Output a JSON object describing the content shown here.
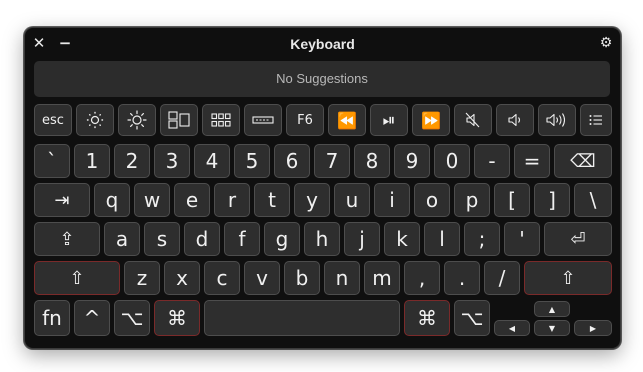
{
  "window": {
    "title": "Keyboard",
    "close_glyph": "✕",
    "minimize_glyph": "−",
    "settings_glyph": "⚙"
  },
  "suggestions": {
    "text": "No Suggestions"
  },
  "function_row": [
    {
      "name": "esc-key",
      "label": "esc"
    },
    {
      "name": "brightness-down-key",
      "icon": "brightness-down-icon"
    },
    {
      "name": "brightness-up-key",
      "icon": "brightness-up-icon"
    },
    {
      "name": "mission-control-key",
      "icon": "mission-control-icon"
    },
    {
      "name": "launchpad-key",
      "icon": "launchpad-icon"
    },
    {
      "name": "keyboard-backlight-key",
      "icon": "keyboard-backlight-icon"
    },
    {
      "name": "f6-key",
      "label": "F6"
    },
    {
      "name": "rewind-key",
      "label": "⏪"
    },
    {
      "name": "play-pause-key",
      "label": "⏯"
    },
    {
      "name": "fast-forward-key",
      "label": "⏩"
    },
    {
      "name": "mute-key",
      "icon": "mute-icon"
    },
    {
      "name": "volume-down-key",
      "icon": "volume-down-icon"
    },
    {
      "name": "volume-up-key",
      "icon": "volume-up-icon"
    },
    {
      "name": "list-key",
      "icon": "list-icon"
    }
  ],
  "number_row": [
    "`",
    "1",
    "2",
    "3",
    "4",
    "5",
    "6",
    "7",
    "8",
    "9",
    "0",
    "-",
    "=",
    "⌫"
  ],
  "qwerty_row": [
    "⇥",
    "q",
    "w",
    "e",
    "r",
    "t",
    "y",
    "u",
    "i",
    "o",
    "p",
    "[",
    "]",
    "\\"
  ],
  "home_row": [
    "⇪",
    "a",
    "s",
    "d",
    "f",
    "g",
    "h",
    "j",
    "k",
    "l",
    ";",
    "'",
    "⏎"
  ],
  "shift_row": [
    "⇧",
    "z",
    "x",
    "c",
    "v",
    "b",
    "n",
    "m",
    ",",
    ".",
    "/",
    "⇧"
  ],
  "bottom_row": {
    "fn": "fn",
    "control": "^",
    "option_left": "⌥",
    "command_left": "⌘",
    "space": "",
    "command_right": "⌘",
    "option_right": "⌥"
  },
  "arrows": {
    "up": "▲",
    "left": "◀",
    "down": "▼",
    "right": "▶"
  },
  "colors": {
    "window_bg": "#0f0f0f",
    "key_bg": "#2e2e2e",
    "key_border": "#4d4d4d",
    "modifier_border": "#7a2a2a"
  }
}
